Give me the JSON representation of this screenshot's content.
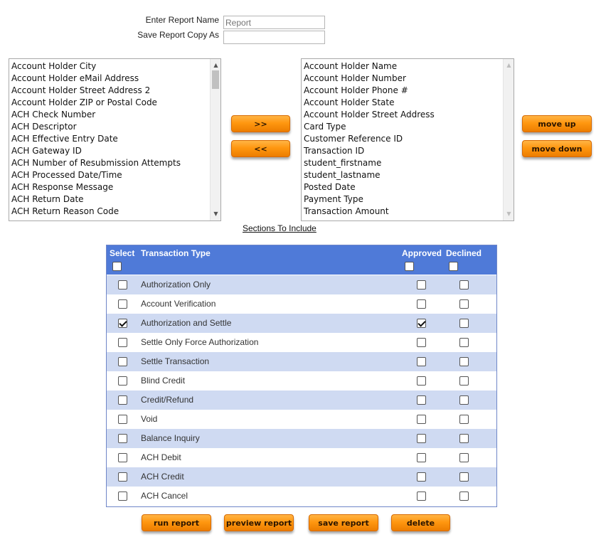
{
  "form": {
    "report_name_label": "Enter Report Name",
    "report_name_placeholder": "Report",
    "report_name_value": "",
    "copy_as_label": "Save Report Copy As",
    "copy_as_value": ""
  },
  "available_fields": [
    "Account Holder City",
    "Account Holder eMail Address",
    "Account Holder Street Address 2",
    "Account Holder ZIP or Postal Code",
    "ACH Check Number",
    "ACH Descriptor",
    "ACH Effective Entry Date",
    "ACH Gateway ID",
    "ACH Number of Resubmission Attempts",
    "ACH Processed Date/Time",
    "ACH Response Message",
    "ACH Return Date",
    "ACH Return Reason Code"
  ],
  "selected_fields": [
    "Account Holder Name",
    "Account Holder Number",
    "Account Holder Phone #",
    "Account Holder State",
    "Account Holder Street Address",
    "Card Type",
    "Customer Reference ID",
    "Transaction ID",
    "student_firstname",
    "student_lastname",
    "Posted Date",
    "Payment Type",
    "Transaction Amount"
  ],
  "buttons": {
    "add": ">>",
    "remove": "<<",
    "move_up": "move up",
    "move_down": "move down",
    "run": "run report",
    "preview": "preview report",
    "save": "save report",
    "delete": "delete"
  },
  "sections_link": "Sections To Include",
  "table": {
    "col_select": "Select",
    "col_type": "Transaction Type",
    "col_approved": "Approved",
    "col_declined": "Declined",
    "rows": [
      {
        "type": "Authorization Only",
        "select": false,
        "approved": false,
        "declined": false
      },
      {
        "type": "Account Verification",
        "select": false,
        "approved": false,
        "declined": false
      },
      {
        "type": "Authorization and Settle",
        "select": true,
        "approved": true,
        "declined": false
      },
      {
        "type": "Settle Only Force Authorization",
        "select": false,
        "approved": false,
        "declined": false
      },
      {
        "type": "Settle Transaction",
        "select": false,
        "approved": false,
        "declined": false
      },
      {
        "type": "Blind Credit",
        "select": false,
        "approved": false,
        "declined": false
      },
      {
        "type": "Credit/Refund",
        "select": false,
        "approved": false,
        "declined": false
      },
      {
        "type": "Void",
        "select": false,
        "approved": false,
        "declined": false
      },
      {
        "type": "Balance Inquiry",
        "select": false,
        "approved": false,
        "declined": false
      },
      {
        "type": "ACH Debit",
        "select": false,
        "approved": false,
        "declined": false
      },
      {
        "type": "ACH Credit",
        "select": false,
        "approved": false,
        "declined": false
      },
      {
        "type": "ACH Cancel",
        "select": false,
        "approved": false,
        "declined": false
      }
    ]
  },
  "colors": {
    "header_blue": "#4f7ad8",
    "row_stripe": "#cfdaf2",
    "button_orange": "#ff9710"
  }
}
